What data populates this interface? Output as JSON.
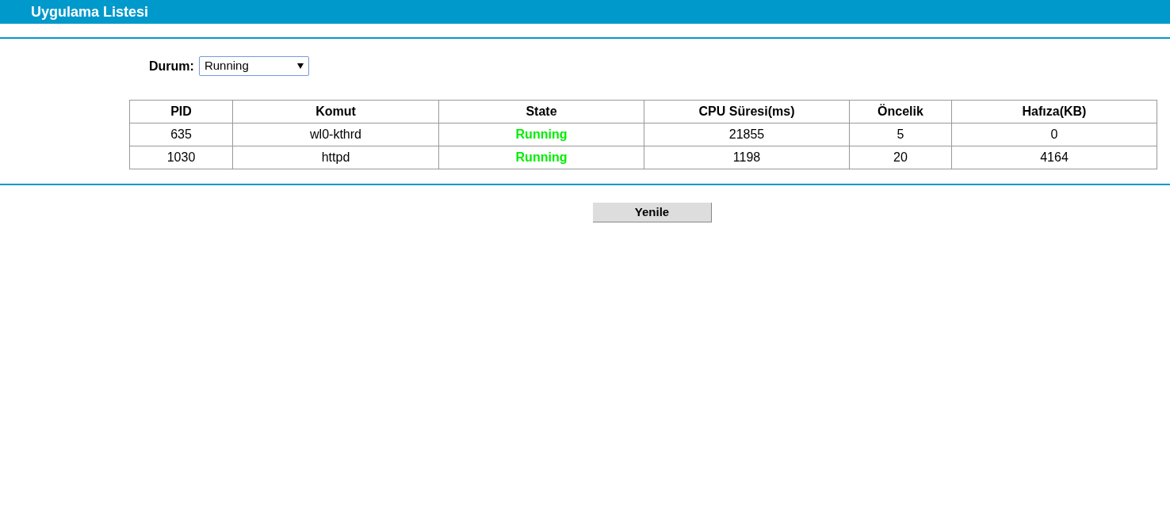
{
  "header": {
    "title": "Uygulama Listesi"
  },
  "filter": {
    "label": "Durum:",
    "value": "Running"
  },
  "table": {
    "columns": [
      "PID",
      "Komut",
      "State",
      "CPU Süresi(ms)",
      "Öncelik",
      "Hafıza(KB)"
    ],
    "rows": [
      {
        "pid": "635",
        "command": "wl0-kthrd",
        "state": "Running",
        "cpu": "21855",
        "priority": "5",
        "memory": "0"
      },
      {
        "pid": "1030",
        "command": "httpd",
        "state": "Running",
        "cpu": "1198",
        "priority": "20",
        "memory": "4164"
      }
    ]
  },
  "refresh_button": "Yenile"
}
